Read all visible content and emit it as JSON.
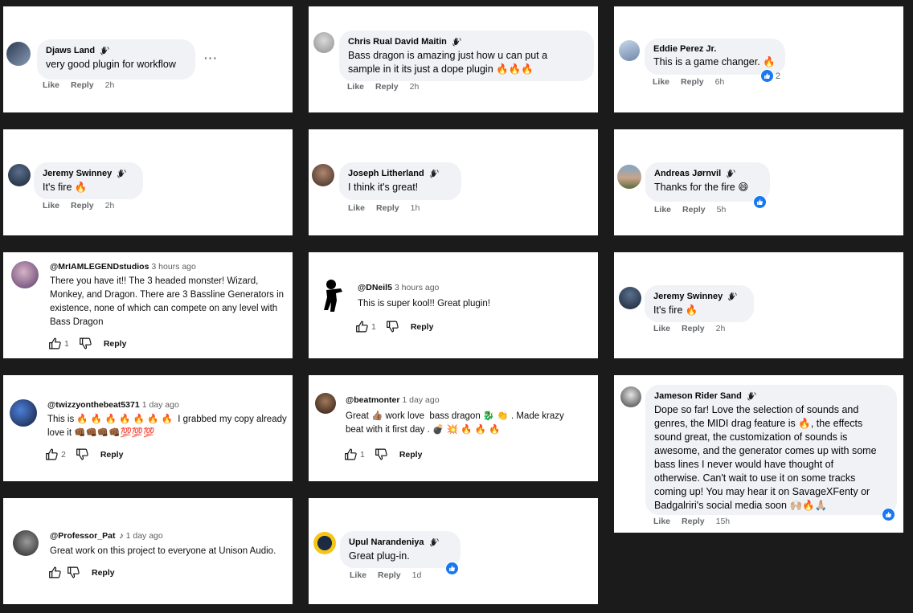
{
  "colors": {
    "background": "#1b1b1b",
    "card": "#ffffff",
    "bubble": "#f0f2f5",
    "fb_blue": "#1877f2",
    "muted": "#65676b"
  },
  "ui": {
    "like": "Like",
    "reply": "Reply"
  },
  "comments": [
    {
      "name": "Djaws Land",
      "text": "very good plugin for workflow",
      "time": "2h"
    },
    {
      "name": "Chris Rual David Maitin",
      "text": "Bass dragon is amazing just how u can put a\nsample in it its just a dope plugin 🔥🔥🔥",
      "time": "2h"
    },
    {
      "name": "Eddie Perez Jr.",
      "text": "This is a game changer. 🔥",
      "time": "6h",
      "reactions": "2"
    },
    {
      "name": "Jeremy Swinney",
      "text": "It's fire 🔥",
      "time": "2h"
    },
    {
      "name": "Joseph Litherland",
      "text": "I think it's great!",
      "time": "1h"
    },
    {
      "name": "Andreas Jørnvil",
      "text": "Thanks for the fire 😄",
      "time": "5h"
    },
    {
      "handle": "@MrIAMLEGENDstudios",
      "age": "3 hours ago",
      "text": "There you have it!! The 3 headed monster! Wizard,\nMonkey, and Dragon. There are 3 Bassline Generators in\nexistence, none of which can compete on any level with\nBass Dragon",
      "likes": "1"
    },
    {
      "handle": "@DNeil5",
      "age": "3 hours ago",
      "text": "This is super kool!! Great plugin!",
      "likes": "1"
    },
    {
      "name": "Jeremy Swinney",
      "text": "It's fire 🔥",
      "time": "2h"
    },
    {
      "handle": "@twizzyonthebeat5371",
      "age": "1 day ago",
      "text": "This is 🔥 🔥 🔥 🔥 🔥 🔥 🔥  I grabbed my copy already\nlove it 👊🏾👊🏾👊🏾👊🏾💯💯💯",
      "likes": "2"
    },
    {
      "handle": "@beatmonter",
      "age": "1 day ago",
      "text": "Great 👍🏽 work love  bass dragon 🐉 👏 . Made krazy\nbeat with it first day . 💣 💥 🔥 🔥 🔥",
      "likes": "1"
    },
    {
      "name": "Jameson Rider Sand",
      "text": "Dope so far! Love the selection of sounds and\ngenres, the MIDI drag feature is 🔥, the effects\nsound great, the customization of sounds is\nawesome, and the generator comes up with some\nbass lines I never would have thought of\notherwise. Can't wait to use it on some tracks\ncoming up! You may hear it on SavageXFenty or\nBadgalriri's social media soon 🙌🏼🔥🙏🏼",
      "time": "15h"
    },
    {
      "handle": "@Professor_Pat",
      "handle_icon": "♪",
      "age": "1 day ago",
      "text": "Great work on this project to everyone at Unison Audio."
    },
    {
      "name": "Upul Narandeniya",
      "text": "Great plug-in.",
      "time": "1d"
    }
  ]
}
